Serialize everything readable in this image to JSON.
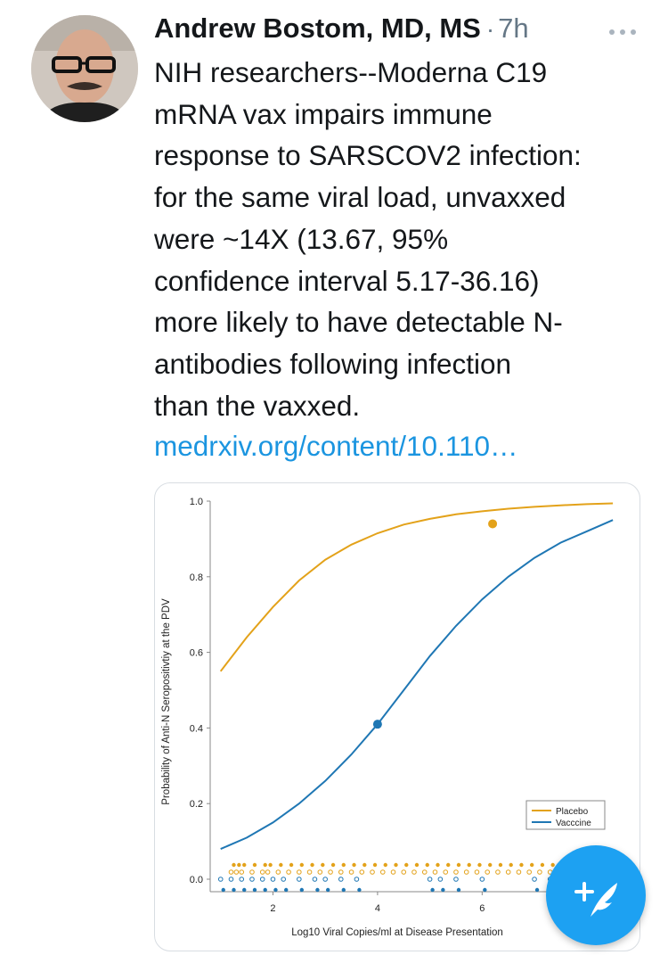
{
  "tweet": {
    "author": "Andrew Bostom, MD, MS",
    "separator": "·",
    "time": "7h",
    "more_icon": "more-dots-icon",
    "text": "NIH researchers--Moderna C19\nmRNA vax impairs immune\nresponse to SARSCOV2 infection:\nfor the same viral load, unvaxxed\nwere ~14X (13.67, 95%\nconfidence interval 5.17-36.16)\nmore likely to have detectable N-\nantibodies following infection\nthan the vaxxed.",
    "link": "medrxiv.org/content/10.110…"
  },
  "compose_button": {
    "icon": "compose-tweet-icon"
  },
  "chart_data": {
    "type": "line",
    "xlabel": "Log10 Viral Copies/ml at Disease Presentation",
    "ylabel": "Probability of Anti-N Seropositivtiy at the PDV",
    "xlim": [
      0.8,
      8.6
    ],
    "ylim": [
      0.0,
      1.0
    ],
    "x_ticks": [
      2,
      4,
      6
    ],
    "y_ticks": [
      "0.0",
      "0.2",
      "0.4",
      "0.6",
      "0.8",
      "1.0"
    ],
    "legend_position": "bottom-right",
    "series": [
      {
        "name": "Placebo",
        "color": "#e3a21a",
        "x": [
          1.0,
          1.5,
          2.0,
          2.5,
          3.0,
          3.5,
          4.0,
          4.5,
          5.0,
          5.5,
          6.0,
          6.5,
          7.0,
          7.5,
          8.0,
          8.5
        ],
        "y": [
          0.55,
          0.64,
          0.72,
          0.79,
          0.845,
          0.885,
          0.915,
          0.938,
          0.953,
          0.965,
          0.973,
          0.98,
          0.985,
          0.989,
          0.992,
          0.994
        ],
        "marker": {
          "x": 6.2,
          "y": 0.94
        },
        "rug": [
          1.2,
          1.3,
          1.4,
          1.6,
          1.8,
          1.9,
          2.1,
          2.3,
          2.5,
          2.7,
          2.9,
          3.1,
          3.3,
          3.5,
          3.7,
          3.9,
          4.1,
          4.3,
          4.5,
          4.7,
          4.9,
          5.1,
          5.3,
          5.5,
          5.7,
          5.9,
          6.1,
          6.3,
          6.5,
          6.7,
          6.9,
          7.1,
          7.3,
          7.5,
          7.7,
          7.9,
          8.1
        ]
      },
      {
        "name": "Vacccine",
        "color": "#1f77b4",
        "x": [
          1.0,
          1.5,
          2.0,
          2.5,
          3.0,
          3.5,
          4.0,
          4.5,
          5.0,
          5.5,
          6.0,
          6.5,
          7.0,
          7.5,
          8.0,
          8.5
        ],
        "y": [
          0.08,
          0.11,
          0.15,
          0.2,
          0.26,
          0.33,
          0.41,
          0.5,
          0.59,
          0.67,
          0.74,
          0.8,
          0.85,
          0.89,
          0.92,
          0.95
        ],
        "marker": {
          "x": 4.0,
          "y": 0.41
        },
        "rug": [
          1.0,
          1.2,
          1.4,
          1.6,
          1.8,
          2.0,
          2.2,
          2.5,
          2.8,
          3.0,
          3.3,
          3.6,
          5.0,
          5.2,
          5.5,
          6.0,
          7.0,
          7.3,
          7.6,
          8.0
        ]
      }
    ]
  }
}
